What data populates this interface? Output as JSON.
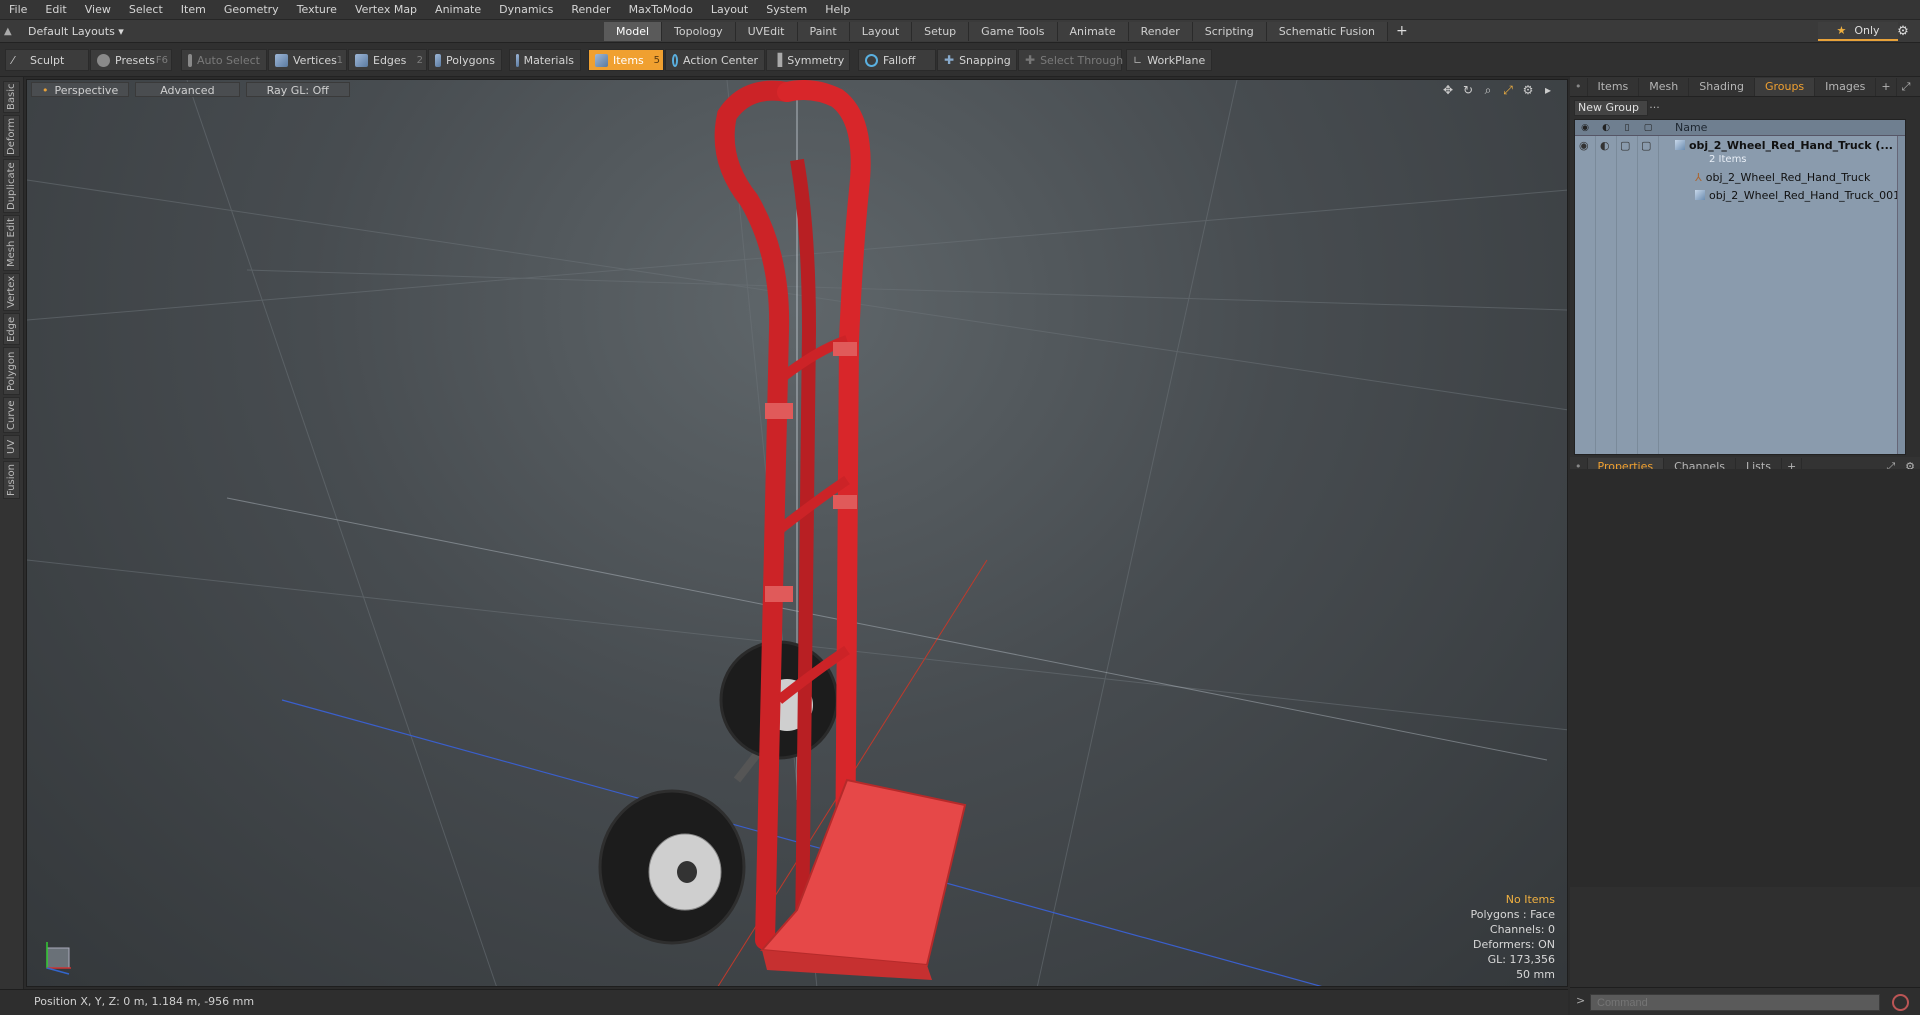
{
  "menu": [
    "File",
    "Edit",
    "View",
    "Select",
    "Item",
    "Geometry",
    "Texture",
    "Vertex Map",
    "Animate",
    "Dynamics",
    "Render",
    "MaxToModo",
    "Layout",
    "System",
    "Help"
  ],
  "layout": {
    "dropdown": "Default Layouts ▾",
    "tabs": [
      "Model",
      "Topology",
      "UVEdit",
      "Paint",
      "Layout",
      "Setup",
      "Game Tools",
      "Animate",
      "Render",
      "Scripting",
      "Schematic Fusion"
    ],
    "active_tab": "Model",
    "plus": "+",
    "only_label": "Only"
  },
  "toolbar": {
    "sculpt": "Sculpt",
    "presets": "Presets",
    "presets_key": "F6",
    "auto_select": "Auto Select",
    "vertices": "Vertices",
    "vertices_key": "1",
    "edges": "Edges",
    "edges_key": "2",
    "polygons": "Polygons",
    "materials": "Materials",
    "items": "Items",
    "items_key": "5",
    "action_center": "Action Center",
    "symmetry": "Symmetry",
    "falloff": "Falloff",
    "snapping": "Snapping",
    "select_through": "Select Through",
    "workplane": "WorkPlane"
  },
  "left_tabs": [
    "Basic",
    "Deform",
    "Duplicate",
    "Mesh Edit",
    "Vertex",
    "Edge",
    "Polygon",
    "Curve",
    "UV",
    "Fusion"
  ],
  "viewport": {
    "view": "Perspective",
    "shading": "Advanced",
    "raygl": "Ray GL: Off",
    "info": {
      "selection": "No Items",
      "polygons": "Polygons : Face",
      "channels": "Channels: 0",
      "deformers": "Deformers: ON",
      "gl": "GL: 173,356",
      "focal": "50 mm"
    }
  },
  "status": {
    "position": "Position X, Y, Z:  0 m, 1.184 m, -956 mm"
  },
  "right_top": {
    "tabs": [
      "Items",
      "Mesh ...",
      "Shading",
      "Groups",
      "Images",
      "+"
    ],
    "active": "Groups",
    "new_group": "New Group",
    "name_header": "Name",
    "rows": [
      {
        "label": "obj_2_Wheel_Red_Hand_Truck (..."
      },
      {
        "label": "2 Items"
      },
      {
        "label": "obj_2_Wheel_Red_Hand_Truck"
      },
      {
        "label": "obj_2_Wheel_Red_Hand_Truck_001"
      }
    ]
  },
  "right_bottom": {
    "tabs": [
      "Properties",
      "Channels",
      "Lists",
      "+"
    ],
    "active": "Properties"
  },
  "command": {
    "placeholder": "Command"
  },
  "colors": {
    "accent": "#f0a030",
    "truck_red": "#d8262a",
    "axis_x": "#c0392b",
    "axis_z": "#3a5fcd"
  }
}
